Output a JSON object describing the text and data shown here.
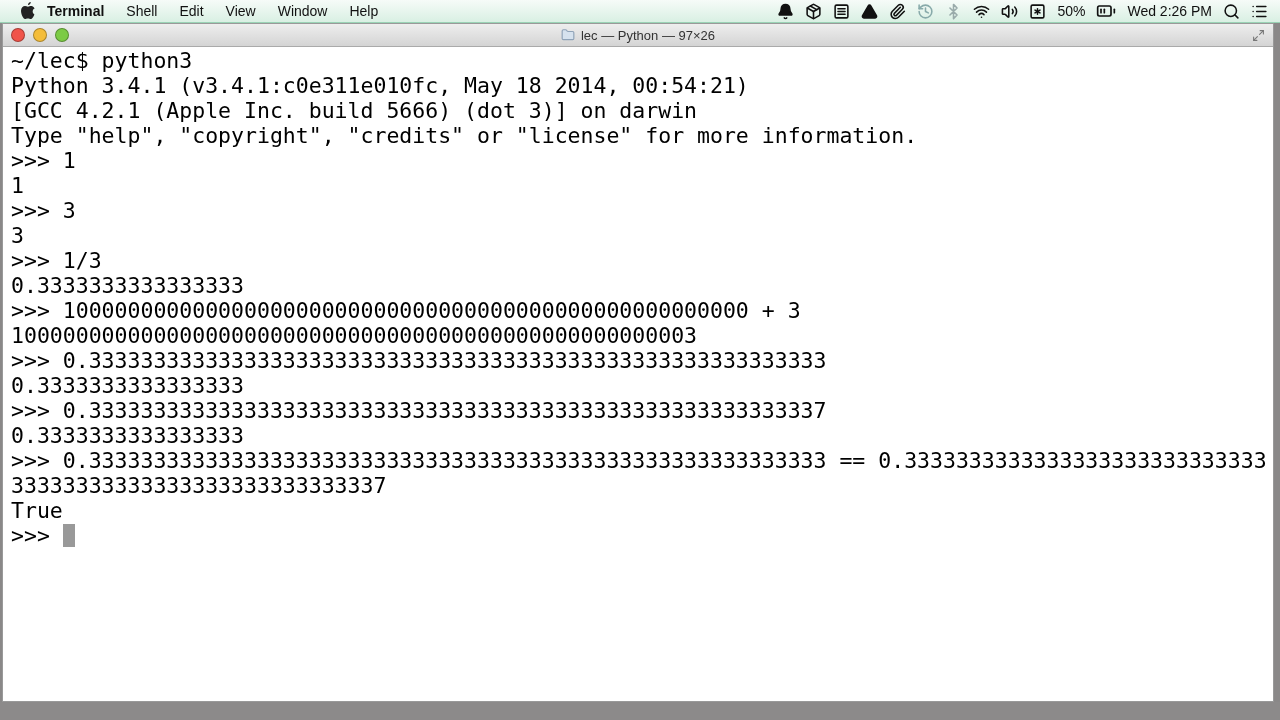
{
  "menu_bar": {
    "app_name": "Terminal",
    "menus": [
      "Shell",
      "Edit",
      "View",
      "Window",
      "Help"
    ],
    "battery_percent": "50%",
    "clock": "Wed 2:26 PM"
  },
  "window": {
    "title": "lec — Python — 97×26"
  },
  "terminal": {
    "lines": [
      "~/lec$ python3",
      "Python 3.4.1 (v3.4.1:c0e311e010fc, May 18 2014, 00:54:21)",
      "[GCC 4.2.1 (Apple Inc. build 5666) (dot 3)] on darwin",
      "Type \"help\", \"copyright\", \"credits\" or \"license\" for more information.",
      ">>> 1",
      "1",
      ">>> 3",
      "3",
      ">>> 1/3",
      "0.3333333333333333",
      ">>> 10000000000000000000000000000000000000000000000000000 + 3",
      "10000000000000000000000000000000000000000000000000003",
      ">>> 0.333333333333333333333333333333333333333333333333333333333",
      "0.3333333333333333",
      ">>> 0.333333333333333333333333333333333333333333333333333333337",
      "0.3333333333333333",
      ">>> 0.333333333333333333333333333333333333333333333333333333333 == 0.3333333333333333333333333333",
      "33333333333333333333333333337",
      "True"
    ],
    "prompt": ">>> ",
    "cursor_visible": true
  }
}
